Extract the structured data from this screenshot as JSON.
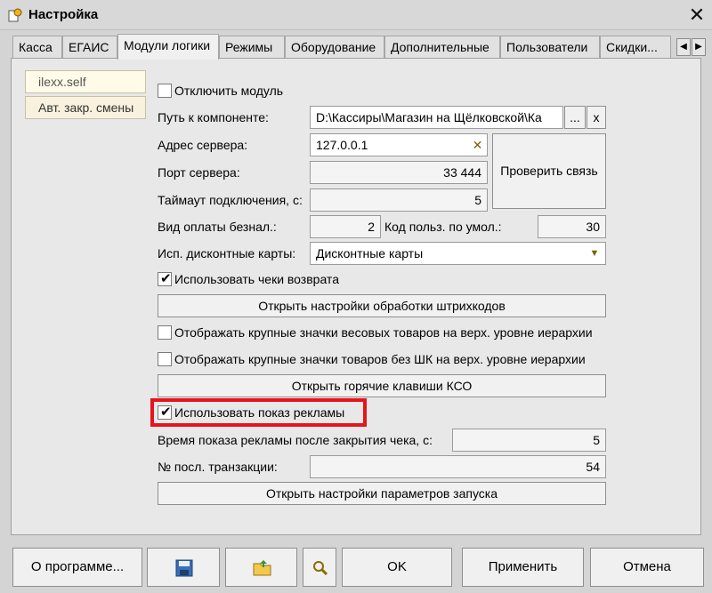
{
  "window": {
    "title": "Настройка"
  },
  "tabs": [
    "Касса",
    "ЕГАИС",
    "Модули логики",
    "Режимы",
    "Оборудование",
    "Дополнительные",
    "Пользователи",
    "Скидки..."
  ],
  "active_tab": 2,
  "modules": [
    "ilexx.self",
    "Авт. закр. смены"
  ],
  "form": {
    "disable_module": "Отключить модуль",
    "component_path_label": "Путь к компоненте:",
    "component_path_value": "D:\\Кассиры\\Магазин на Щёлковской\\Ка",
    "browse_button": "...",
    "clear_button": "x",
    "server_address_label": "Адрес сервера:",
    "server_address_value": "127.0.0.1",
    "check_connection_button": "Проверить связь",
    "server_port_label": "Порт сервера:",
    "server_port_value": "33 444",
    "timeout_label": "Таймаут подключения, с:",
    "timeout_value": "5",
    "noncash_label": "Вид оплаты безнал.:",
    "noncash_value": "2",
    "default_user_label": "Код польз. по умол.:",
    "default_user_value": "30",
    "discount_cards_label": "Исп. дисконтные карты:",
    "discount_cards_value": "Дисконтные карты",
    "use_return_checks": "Использовать чеки возврата",
    "barcode_settings_button": "Открыть настройки обработки штрихкодов",
    "weight_icons": "Отображать крупные значки весовых товаров на верх. уровне иерархии",
    "nobarcode_icons": "Отображать крупные значки товаров без ШК на верх. уровне иерархии",
    "hotkeys_button": "Открыть горячие клавиши КСО",
    "use_ads": "Использовать показ рекламы",
    "ad_time_label": "Время показа рекламы после закрытия чека, с:",
    "ad_time_value": "5",
    "last_transaction_label": "№ посл. транзакции:",
    "last_transaction_value": "54",
    "launch_params_button": "Открыть настройки параметров запуска"
  },
  "checkboxes": {
    "disable_module": false,
    "use_return_checks": true,
    "weight_icons": false,
    "nobarcode_icons": false,
    "use_ads": true
  },
  "bottom": {
    "about_button": "О программе...",
    "ok_button": "OK",
    "apply_button": "Применить",
    "cancel_button": "Отмена"
  },
  "colors": {
    "highlight": "#e8131b",
    "module_bg": "#f7f1dd"
  },
  "icons": {
    "save": "floppy-disk-icon",
    "open": "folder-open-icon",
    "search": "magnifier-icon",
    "clear": "clear-x-icon",
    "dropdown": "dropdown-arrow-icon"
  }
}
